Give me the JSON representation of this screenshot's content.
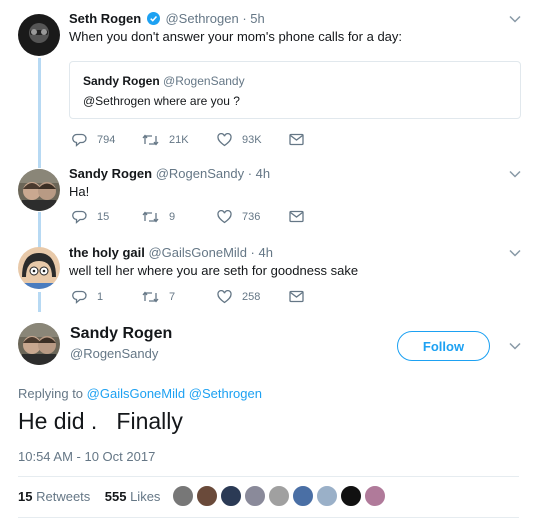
{
  "thread": [
    {
      "name": "Seth Rogen",
      "verified": true,
      "handle": "@Sethrogen",
      "time": "· 5h",
      "text": "When you don't answer your mom's phone calls for a day:",
      "quote": {
        "name": "Sandy Rogen",
        "handle": "@RogenSandy",
        "text": "@Sethrogen where are you ?"
      },
      "replies": "794",
      "retweets": "21K",
      "likes": "93K"
    },
    {
      "name": "Sandy Rogen",
      "handle": "@RogenSandy",
      "time": "· 4h",
      "text": "Ha!",
      "replies": "15",
      "retweets": "9",
      "likes": "736"
    },
    {
      "name": "the holy gail",
      "handle": "@GailsGoneMild",
      "time": "· 4h",
      "text": "well tell her where you are seth for goodness sake",
      "replies": "1",
      "retweets": "7",
      "likes": "258"
    }
  ],
  "main_tweet": {
    "name": "Sandy Rogen",
    "handle": "@RogenSandy",
    "follow_label": "Follow",
    "replying_prefix": "Replying to",
    "replying_to": [
      "@GailsGoneMild",
      "@Sethrogen"
    ],
    "text": "He did .   Finally",
    "timestamp": "10:54 AM - 10 Oct 2017",
    "retweets_count": "15",
    "retweets_label": "Retweets",
    "likes_count": "555",
    "likes_label": "Likes"
  },
  "icons": [
    "reply-icon",
    "retweet-icon",
    "like-icon",
    "message-icon",
    "chevron-down-icon",
    "verified-icon"
  ],
  "colors": {
    "accent": "#1da1f2",
    "muted": "#657786",
    "thread_line": "#b7d9f3",
    "text": "#14171a"
  }
}
